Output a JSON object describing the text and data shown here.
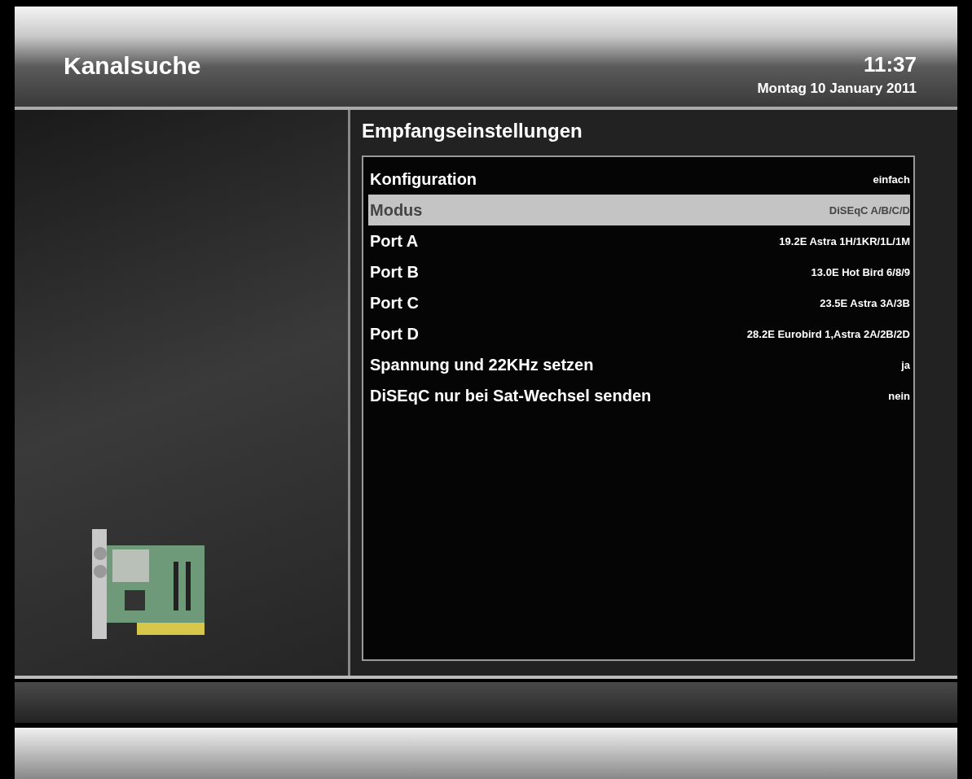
{
  "header": {
    "title": "Kanalsuche",
    "time": "11:37",
    "date": "Montag 10 January 2011"
  },
  "panel": {
    "title": "Empfangseinstellungen",
    "settings": [
      {
        "label": "Konfiguration",
        "value": "einfach",
        "selected": false
      },
      {
        "label": "Modus",
        "value": "DiSEqC A/B/C/D",
        "selected": true
      },
      {
        "label": "Port A",
        "value": "19.2E Astra 1H/1KR/1L/1M",
        "selected": false
      },
      {
        "label": "Port B",
        "value": "13.0E Hot Bird 6/8/9",
        "selected": false
      },
      {
        "label": "Port C",
        "value": "23.5E Astra 3A/3B",
        "selected": false
      },
      {
        "label": "Port D",
        "value": "28.2E Eurobird 1,Astra 2A/2B/2D",
        "selected": false
      },
      {
        "label": "Spannung und 22KHz setzen",
        "value": "ja",
        "selected": false
      },
      {
        "label": "DiSEqC nur bei Sat-Wechsel senden",
        "value": "nein",
        "selected": false
      }
    ]
  }
}
